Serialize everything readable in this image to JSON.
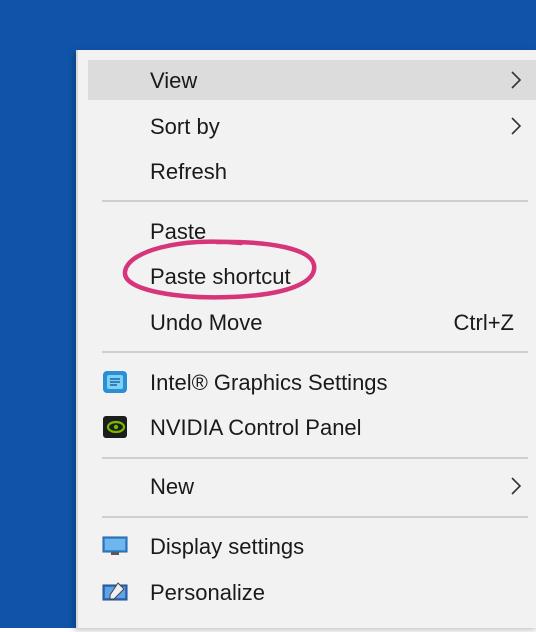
{
  "context_menu": {
    "items": [
      {
        "label": "View",
        "submenu": true
      },
      {
        "label": "Sort by",
        "submenu": true
      },
      {
        "label": "Refresh"
      },
      {
        "label": "Paste"
      },
      {
        "label": "Paste shortcut"
      },
      {
        "label": "Undo Move",
        "shortcut": "Ctrl+Z"
      },
      {
        "label": "Intel® Graphics Settings",
        "icon": "intel-graphics-icon"
      },
      {
        "label": "NVIDIA Control Panel",
        "icon": "nvidia-icon"
      },
      {
        "label": "New",
        "submenu": true
      },
      {
        "label": "Display settings",
        "icon": "display-settings-icon"
      },
      {
        "label": "Personalize",
        "icon": "personalize-icon"
      }
    ]
  },
  "annotation": {
    "target": "Paste shortcut",
    "color": "#d6357a"
  },
  "colors": {
    "desktop": "#0f54a9",
    "menu_bg": "#f2f2f2",
    "hover": "#dcdcdc"
  }
}
